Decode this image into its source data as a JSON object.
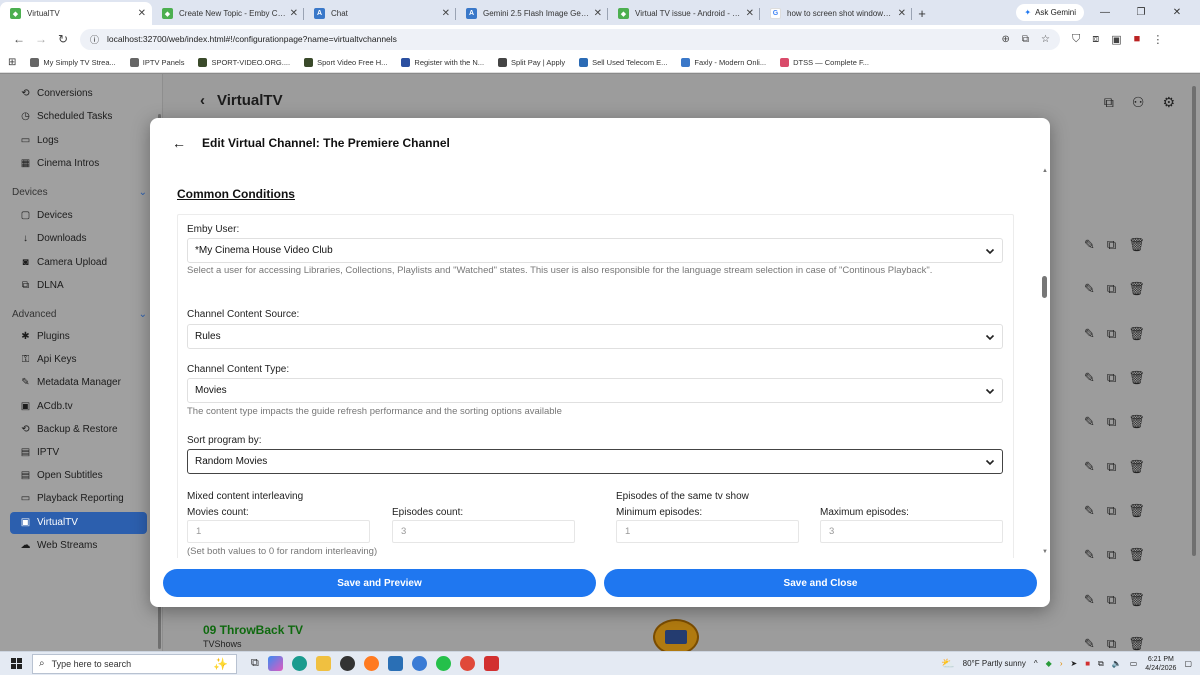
{
  "browser": {
    "tabs": [
      {
        "title": "VirtualTV",
        "color": "#4caf50",
        "glyph": "◆"
      },
      {
        "title": "Create New Topic - Emby Comm",
        "color": "#4caf50",
        "glyph": "◆"
      },
      {
        "title": "Chat",
        "color": "#3a78c9",
        "glyph": "A"
      },
      {
        "title": "Gemini 2.5 Flash Image Genera",
        "color": "#3a78c9",
        "glyph": "A"
      },
      {
        "title": "Virtual TV issue - Android - Emb",
        "color": "#4caf50",
        "glyph": "◆"
      },
      {
        "title": "how to screen shot windows 11",
        "color": "#ffffff",
        "glyph": "G"
      }
    ],
    "new_tab": "+",
    "ask_gemini": "Ask Gemini",
    "url": "localhost:32700/web/index.html#!/configurationpage?name=virtualtvchannels",
    "bookmarks": [
      {
        "label": "My Simply TV Strea...",
        "color": "#666666"
      },
      {
        "label": "IPTV Panels",
        "color": "#666666"
      },
      {
        "label": "SPORT-VIDEO.ORG....",
        "color": "#3a4a2a"
      },
      {
        "label": "Sport Video Free H...",
        "color": "#3a4a2a"
      },
      {
        "label": "Register with the N...",
        "color": "#2b4fa0"
      },
      {
        "label": "Split Pay | Apply",
        "color": "#444444"
      },
      {
        "label": "Sell Used Telecom E...",
        "color": "#2b6bb5"
      },
      {
        "label": "Faxly - Modern Onli...",
        "color": "#3a78c9"
      },
      {
        "label": "DTSS — Complete F...",
        "color": "#d94b6a"
      }
    ]
  },
  "app": {
    "title": "VirtualTV",
    "sidebar": {
      "items_top": [
        {
          "label": "Conversions",
          "icon": "⟲"
        },
        {
          "label": "Scheduled Tasks",
          "icon": "◷"
        },
        {
          "label": "Logs",
          "icon": "▭"
        },
        {
          "label": "Cinema Intros",
          "icon": "▦"
        }
      ],
      "devices_header": "Devices",
      "devices": [
        {
          "label": "Devices",
          "icon": "▢"
        },
        {
          "label": "Downloads",
          "icon": "↓"
        },
        {
          "label": "Camera Upload",
          "icon": "◙"
        },
        {
          "label": "DLNA",
          "icon": "⧉"
        }
      ],
      "advanced_header": "Advanced",
      "advanced": [
        {
          "label": "Plugins",
          "icon": "✱"
        },
        {
          "label": "Api Keys",
          "icon": "⚿"
        },
        {
          "label": "Metadata Manager",
          "icon": "✎"
        },
        {
          "label": "ACdb.tv",
          "icon": "▣"
        },
        {
          "label": "Backup & Restore",
          "icon": "⟲"
        },
        {
          "label": "IPTV",
          "icon": "▤"
        },
        {
          "label": "Open Subtitles",
          "icon": "▤"
        },
        {
          "label": "Playback Reporting",
          "icon": "▭"
        },
        {
          "label": "VirtualTV",
          "icon": "▣"
        },
        {
          "label": "Web Streams",
          "icon": "☁"
        }
      ]
    },
    "bg_channel": {
      "name": "09 ThrowBack TV",
      "type": "TVShows"
    }
  },
  "modal": {
    "title": "Edit Virtual Channel: The Premiere Channel",
    "section": "Common Conditions",
    "emby_user": {
      "label": "Emby User:",
      "value": "*My Cinema House Video Club",
      "help": "Select a user for accessing Libraries, Collections, Playlists and \"Watched\" states. This user is also responsible for the language stream selection in case of \"Continous Playback\"."
    },
    "content_source": {
      "label": "Channel Content Source:",
      "value": "Rules"
    },
    "content_type": {
      "label": "Channel Content Type:",
      "value": "Movies",
      "help": "The content type impacts the guide refresh performance and the sorting options available"
    },
    "sort_by": {
      "label": "Sort program by:",
      "value": "Random Movies"
    },
    "interleave": {
      "title": "Mixed content interleaving",
      "movies_label": "Movies count:",
      "movies_value": "1",
      "episodes_label": "Episodes count:",
      "episodes_value": "3",
      "help": "(Set both values to 0 for random interleaving)"
    },
    "same_show": {
      "title": "Episodes of the same tv show",
      "min_label": "Minimum episodes:",
      "min_value": "1",
      "max_label": "Maximum episodes:",
      "max_value": "3"
    },
    "save_preview": "Save and Preview",
    "save_close": "Save and Close"
  },
  "taskbar": {
    "search_placeholder": "Type here to search",
    "weather": "80°F  Partly sunny",
    "time": "6:21 PM",
    "date": "4/24/2026"
  },
  "colors": {
    "accent": "#1f77f0",
    "sidebar_active": "#2c5fae",
    "channel_green": "#0f6a0f"
  }
}
